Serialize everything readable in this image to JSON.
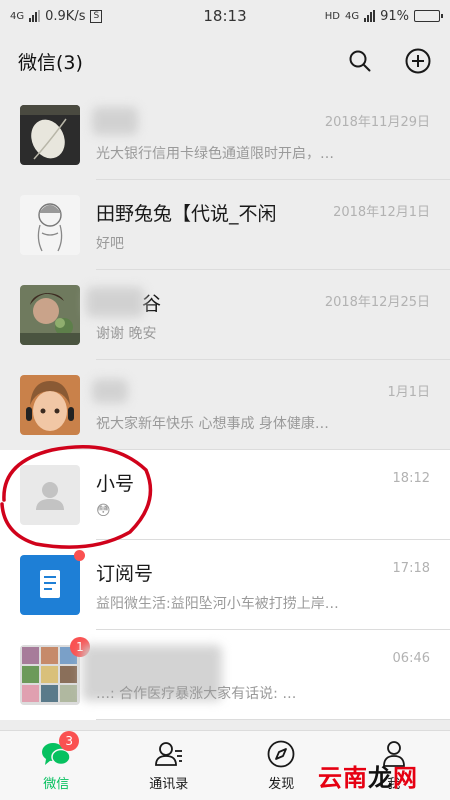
{
  "status_bar": {
    "network_left": "4G",
    "speed": "0.9K/s",
    "s_box": "S",
    "time": "18:13",
    "hd": "HD",
    "network_right": "4G",
    "battery": "91%",
    "battery_level": 0.91
  },
  "header": {
    "title": "微信(3)",
    "search_icon": "search-icon",
    "add_icon": "plus-circle-icon"
  },
  "chats": [
    {
      "name": "",
      "time": "2018年11月29日",
      "message": "光大银行信用卡绿色通道限时开启，…",
      "background": "gray"
    },
    {
      "name": "田野兔兔【代说_不闲",
      "time": "2018年12月1日",
      "message": "好吧",
      "background": "gray"
    },
    {
      "name": "谷",
      "time": "2018年12月25日",
      "message": "谢谢  晚安",
      "background": "gray"
    },
    {
      "name": "",
      "time": "1月1日",
      "message": "祝大家新年快乐 心想事成 身体健康…",
      "background": "gray"
    },
    {
      "name": "小号",
      "time": "18:12",
      "message": "😳",
      "background": "white"
    },
    {
      "name": "订阅号",
      "time": "17:18",
      "message": "益阳微生活:益阳坠河小车被打捞上岸…",
      "background": "white"
    },
    {
      "name": "",
      "time": "06:46",
      "message": "…: 合作医疗暴涨大家有话说: …",
      "background": "white",
      "badge": "1"
    }
  ],
  "tabs": [
    {
      "label": "微信",
      "icon": "chat-bubbles-icon",
      "active": true,
      "badge": "3"
    },
    {
      "label": "通讯录",
      "icon": "contacts-icon",
      "active": false
    },
    {
      "label": "发现",
      "icon": "compass-icon",
      "active": false
    },
    {
      "label": "我",
      "icon": "person-icon",
      "active": false
    }
  ],
  "watermark": {
    "part1": "云南",
    "part2": "龙",
    "part3": "网"
  },
  "colors": {
    "accent_green": "#07c160",
    "badge_red": "#fa5151",
    "annotation_red": "#d0021b",
    "subscription_blue": "#1e7fd6"
  }
}
